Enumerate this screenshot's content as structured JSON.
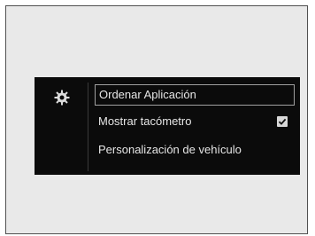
{
  "menu": {
    "icon": "gear-icon",
    "items": [
      {
        "label": "Ordenar Aplicación",
        "selected": true
      },
      {
        "label": "Mostrar tacómetro",
        "checked": true
      },
      {
        "label": "Personalización de vehículo"
      }
    ]
  },
  "colors": {
    "panel_background": "#0b0b0b",
    "page_background": "#e9e9e9",
    "text": "#e6e6e6",
    "selection_border": "#a0a0a0"
  }
}
